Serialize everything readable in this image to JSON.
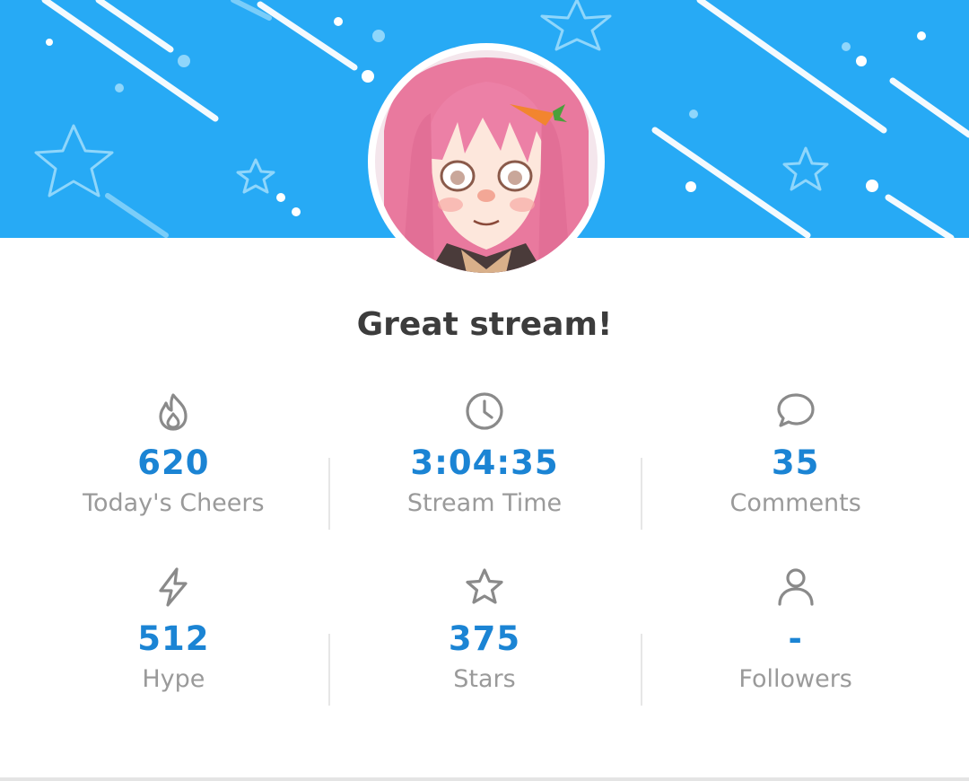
{
  "header": {
    "title": "Great stream!"
  },
  "theme": {
    "banner_color": "#27aaf5",
    "value_color": "#1b84d4",
    "label_color": "#9a9a9a"
  },
  "stats": [
    {
      "icon": "fire-icon",
      "value": "620",
      "label": "Today's Cheers"
    },
    {
      "icon": "clock-icon",
      "value": "3:04:35",
      "label": "Stream Time"
    },
    {
      "icon": "comment-icon",
      "value": "35",
      "label": "Comments"
    },
    {
      "icon": "lightning-icon",
      "value": "512",
      "label": "Hype"
    },
    {
      "icon": "star-icon",
      "value": "375",
      "label": "Stars"
    },
    {
      "icon": "user-icon",
      "value": "-",
      "label": "Followers"
    }
  ]
}
